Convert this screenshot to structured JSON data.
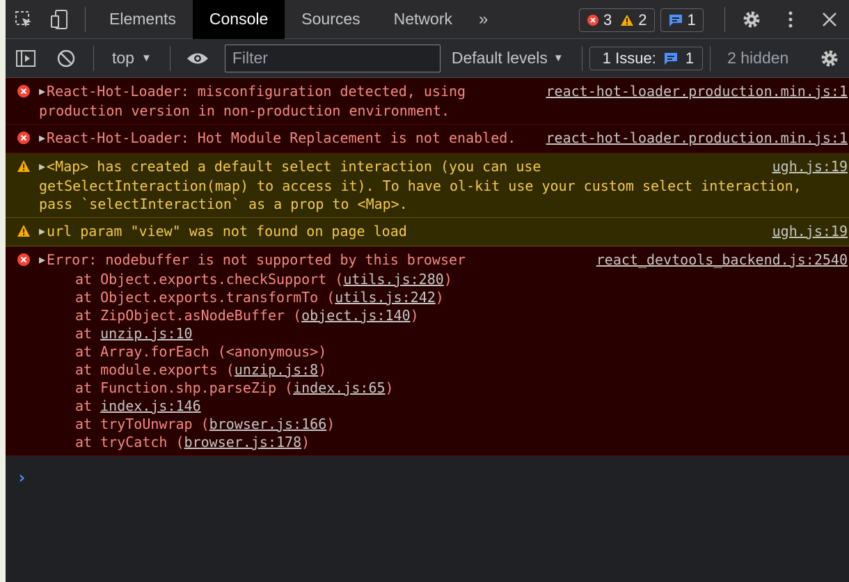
{
  "tabs": [
    {
      "label": "Elements",
      "active": false
    },
    {
      "label": "Console",
      "active": true
    },
    {
      "label": "Sources",
      "active": false
    },
    {
      "label": "Network",
      "active": false
    }
  ],
  "more_tabs": "»",
  "counters": {
    "errors": "3",
    "warnings": "2",
    "messages": "1"
  },
  "toolbar": {
    "context": "top",
    "filter_placeholder": "Filter",
    "levels": "Default levels",
    "issues_label": "1 Issue:",
    "issues_count": "1",
    "hidden": "2 hidden"
  },
  "messages": [
    {
      "level": "error",
      "text": "React-Hot-Loader: misconfiguration detected, using production version in non-production environment.",
      "source": "react-hot-loader.production.min.js:1"
    },
    {
      "level": "error",
      "text": "React-Hot-Loader: Hot Module Replacement is not enabled.",
      "source": "react-hot-loader.production.min.js:1"
    },
    {
      "level": "warning",
      "text": "<Map> has created a default select interaction (you can use getSelectInteraction(map) to access it). To have ol-kit use your custom select interaction, pass `selectInteraction` as a prop to <Map>.",
      "source": "ugh.js:19"
    },
    {
      "level": "warning",
      "text": "url param \"view\" was not found on page load",
      "source": "ugh.js:19"
    },
    {
      "level": "error",
      "text": "Error: nodebuffer is not supported by this browser",
      "source": "react_devtools_backend.js:2540",
      "stack": [
        {
          "pre": "at Object.exports.checkSupport (",
          "link": "utils.js:280",
          "post": ")"
        },
        {
          "pre": "at Object.exports.transformTo (",
          "link": "utils.js:242",
          "post": ")"
        },
        {
          "pre": "at ZipObject.asNodeBuffer (",
          "link": "object.js:140",
          "post": ")"
        },
        {
          "pre": "at ",
          "link": "unzip.js:10",
          "post": ""
        },
        {
          "pre": "at Array.forEach (<anonymous>)",
          "link": "",
          "post": ""
        },
        {
          "pre": "at module.exports (",
          "link": "unzip.js:8",
          "post": ")"
        },
        {
          "pre": "at Function.shp.parseZip (",
          "link": "index.js:65",
          "post": ")"
        },
        {
          "pre": "at ",
          "link": "index.js:146",
          "post": ""
        },
        {
          "pre": "at tryToUnwrap (",
          "link": "browser.js:166",
          "post": ")"
        },
        {
          "pre": "at tryCatch (",
          "link": "browser.js:178",
          "post": ")"
        }
      ]
    }
  ],
  "prompt": "›",
  "colors": {
    "error_bg": "#290000",
    "error_text": "#f28b82",
    "warning_bg": "#332b00",
    "warning_text": "#f2c94c",
    "accent": "#4d90fe"
  }
}
